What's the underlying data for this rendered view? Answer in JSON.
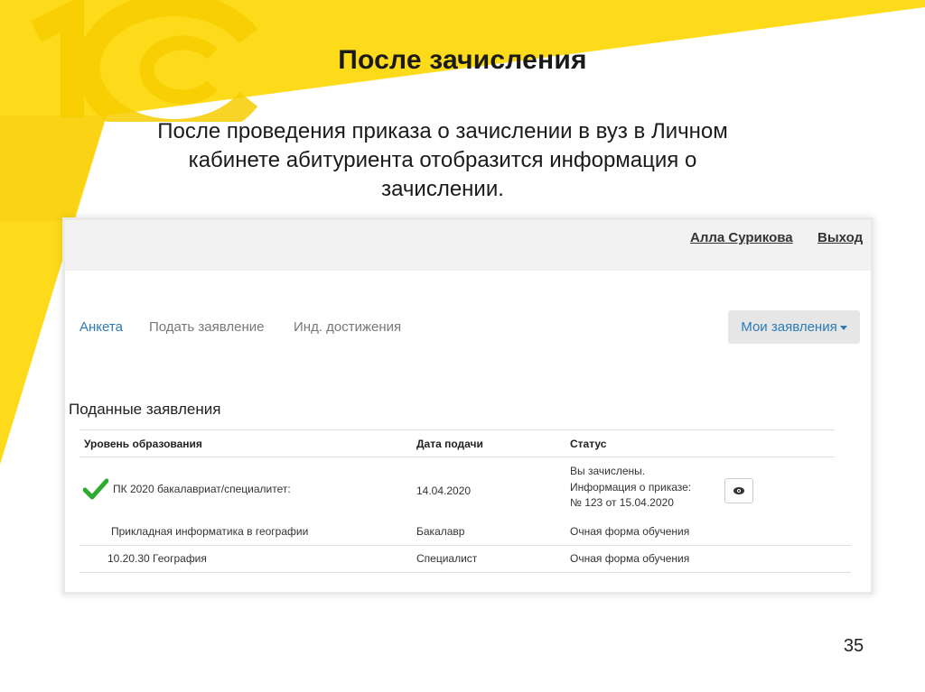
{
  "slide": {
    "title": "После зачисления",
    "text": "После проведения приказа о зачислении в вуз в Личном кабинете абитуриента отобразится информация о зачислении.",
    "page_number": "35"
  },
  "colors": {
    "yellow_bg": "#fddb1a",
    "yellow_dark": "#f8cd00",
    "link_blue": "#2a7bb8",
    "check_green": "#2eaa2e"
  },
  "app": {
    "header": {
      "user_name": "Алла Сурикова",
      "logout_label": "Выход"
    },
    "nav": {
      "tabs": [
        {
          "label": "Анкета",
          "active": true
        },
        {
          "label": "Подать заявление",
          "active": false
        },
        {
          "label": "Инд. достижения",
          "active": false
        }
      ],
      "dropdown_label": "Мои заявления"
    },
    "applications": {
      "title": "Поданные заявления",
      "columns": [
        "Уровень образования",
        "Дата подачи",
        "Статус"
      ],
      "main_row": {
        "level": "ПК 2020 бакалавриат/специалитет:",
        "date": "14.04.2020",
        "status_lines": [
          "Вы зачислены.",
          "Информация о приказе:",
          "№ 123 от 15.04.2020"
        ],
        "icon": "eye-icon"
      },
      "sub_rows": [
        {
          "name": "Прикладная информатика в географии",
          "level": "Бакалавр",
          "form": "Очная форма обучения"
        },
        {
          "name": "10.20.30 География",
          "level": "Специалист",
          "form": "Очная форма обучения"
        }
      ]
    }
  }
}
